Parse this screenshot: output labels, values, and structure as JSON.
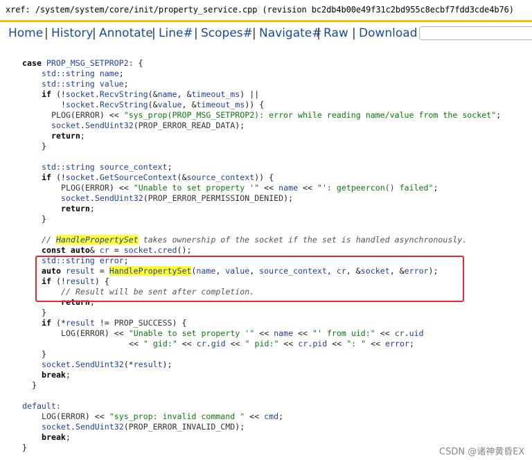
{
  "window": {
    "title": "xref: /system/system/core/init/property_service.cpp (revision bc2db4b00e49f31c2bd955c8ecbf7fdd3cde4b76)"
  },
  "nav": {
    "items": [
      "Home",
      "History",
      "Annotate",
      "Line#",
      "Scopes#",
      "Navigate#",
      "Raw",
      "Download"
    ],
    "separator": "|",
    "search_placeholder": ""
  },
  "code_lines": [
    {
      "indent": 4,
      "text": "case PROP_MSG_SETPROP2: {"
    },
    {
      "indent": 8,
      "text": "std::string name;"
    },
    {
      "indent": 8,
      "text": "std::string value;"
    },
    {
      "indent": 8,
      "text": "if (!socket.RecvString(&name, &timeout_ms) ||"
    },
    {
      "indent": 12,
      "text": "!socket.RecvString(&value, &timeout_ms)) {"
    },
    {
      "indent": 10,
      "text": "PLOG(ERROR) << \"sys_prop(PROP_MSG_SETPROP2): error while reading name/value from the socket\";"
    },
    {
      "indent": 10,
      "text": "socket.SendUint32(PROP_ERROR_READ_DATA);"
    },
    {
      "indent": 10,
      "text": "return;"
    },
    {
      "indent": 8,
      "text": "}"
    },
    {
      "indent": 0,
      "text": ""
    },
    {
      "indent": 8,
      "text": "std::string source_context;"
    },
    {
      "indent": 8,
      "text": "if (!socket.GetSourceContext(&source_context)) {"
    },
    {
      "indent": 12,
      "text": "PLOG(ERROR) << \"Unable to set property '\" << name << \"': getpeercon() failed\";"
    },
    {
      "indent": 12,
      "text": "socket.SendUint32(PROP_ERROR_PERMISSION_DENIED);"
    },
    {
      "indent": 12,
      "text": "return;"
    },
    {
      "indent": 8,
      "text": "}"
    },
    {
      "indent": 0,
      "text": ""
    },
    {
      "indent": 8,
      "text": "// HandlePropertySet takes ownership of the socket if the set is handled asynchronously."
    },
    {
      "indent": 8,
      "text": "const auto& cr = socket.cred();"
    },
    {
      "indent": 8,
      "text": "std::string error;"
    },
    {
      "indent": 8,
      "text": "auto result = HandlePropertySet(name, value, source_context, cr, &socket, &error);"
    },
    {
      "indent": 8,
      "text": "if (!result) {"
    },
    {
      "indent": 12,
      "text": "// Result will be sent after completion."
    },
    {
      "indent": 12,
      "text": "return;"
    },
    {
      "indent": 8,
      "text": "}"
    },
    {
      "indent": 8,
      "text": "if (*result != PROP_SUCCESS) {"
    },
    {
      "indent": 12,
      "text": "LOG(ERROR) << \"Unable to set property '\" << name << \"' from uid:\" << cr.uid"
    },
    {
      "indent": 26,
      "text": "<< \" gid:\" << cr.gid << \" pid:\" << cr.pid << \": \" << error;"
    },
    {
      "indent": 8,
      "text": "}"
    },
    {
      "indent": 8,
      "text": "socket.SendUint32(*result);"
    },
    {
      "indent": 8,
      "text": "break;"
    },
    {
      "indent": 6,
      "text": "}"
    },
    {
      "indent": 0,
      "text": ""
    },
    {
      "indent": 4,
      "text": "default:"
    },
    {
      "indent": 8,
      "text": "LOG(ERROR) << \"sys_prop: invalid command \" << cmd;"
    },
    {
      "indent": 8,
      "text": "socket.SendUint32(PROP_ERROR_INVALID_CMD);"
    },
    {
      "indent": 8,
      "text": "break;"
    },
    {
      "indent": 4,
      "text": "}"
    }
  ],
  "watermark": "CSDN @诸神黄昏EX",
  "colors": {
    "title_underline": "#f2c200",
    "link": "#1a4a9e",
    "highlight": "#ffff33",
    "annotation_box": "#e8262f",
    "string": "#0a7a0a"
  }
}
